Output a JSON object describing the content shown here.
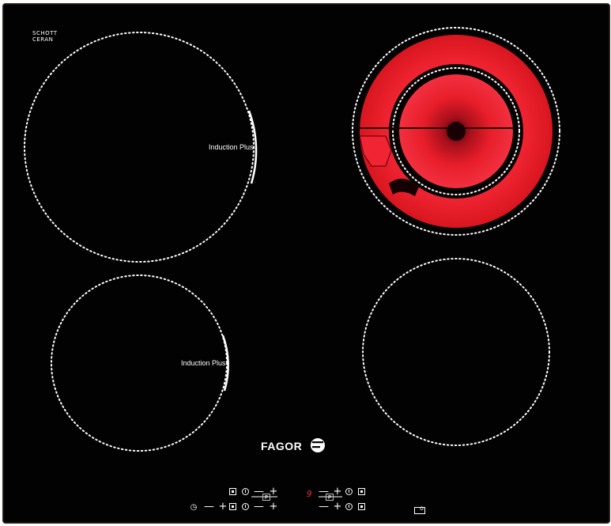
{
  "product": {
    "brand": "FAGOR",
    "glass_brand": [
      "SCHOTT",
      "CERAN"
    ]
  },
  "zones": [
    {
      "id": "rear-left",
      "label": "Induction Plus",
      "state": "off"
    },
    {
      "id": "front-left",
      "label": "Induction Plus",
      "state": "off"
    },
    {
      "id": "rear-right",
      "label": "",
      "state": "on"
    },
    {
      "id": "front-right",
      "label": "",
      "state": "off"
    }
  ],
  "controls": {
    "left_row_top": [
      "box-icon",
      "power-icon",
      "minus",
      "plus"
    ],
    "left_row_bottom": [
      "timer-icon",
      "minus",
      "plus",
      "p-icon",
      "box-icon",
      "power-icon",
      "minus",
      "plus"
    ],
    "right_row_top": [
      "digit",
      "minus",
      "plus",
      "power-icon",
      "box-icon"
    ],
    "right_row_bottom": [
      "p-icon",
      "minus",
      "plus",
      "power-icon",
      "box-icon"
    ],
    "display_digit": "9",
    "minus_symbol": "—",
    "plus_symbol": "+",
    "timer_symbol": "◷",
    "p_symbol": "P"
  },
  "colors": {
    "glass": "#020202",
    "hot_zone": "#ee1c25",
    "markings": "#ffffff",
    "display_red": "#e8283a"
  }
}
